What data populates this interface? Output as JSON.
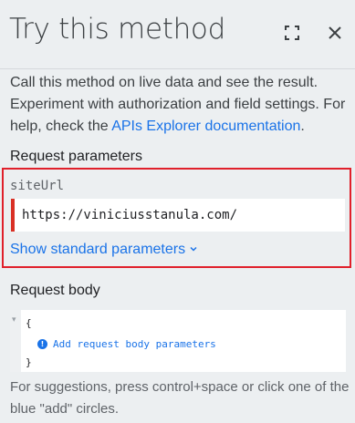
{
  "header": {
    "title": "Try this method",
    "fullscreen_icon": "fullscreen-icon",
    "close_icon": "close-icon"
  },
  "description": {
    "text": "Call this method on live data and see the result. Experiment with authorization and field settings. For help, check the ",
    "link_text": "APIs Explorer documentation",
    "suffix": "."
  },
  "request_parameters": {
    "title": "Request parameters",
    "param_name": "siteUrl",
    "param_value": "https://viniciusstanula.com/",
    "show_standard_label": "Show standard parameters",
    "show_standard_icon": "chevron-down-icon"
  },
  "request_body": {
    "title": "Request body",
    "open_brace": "{",
    "add_link": "Add request body parameters",
    "close_brace": "}",
    "info_icon": "info-icon"
  },
  "hint": "For suggestions, press control+space or click one of the blue \"add\" circles.",
  "colors": {
    "accent": "#1a73e8",
    "highlight_border": "#e0202b",
    "required_marker": "#d93025",
    "background": "#eceff1"
  }
}
